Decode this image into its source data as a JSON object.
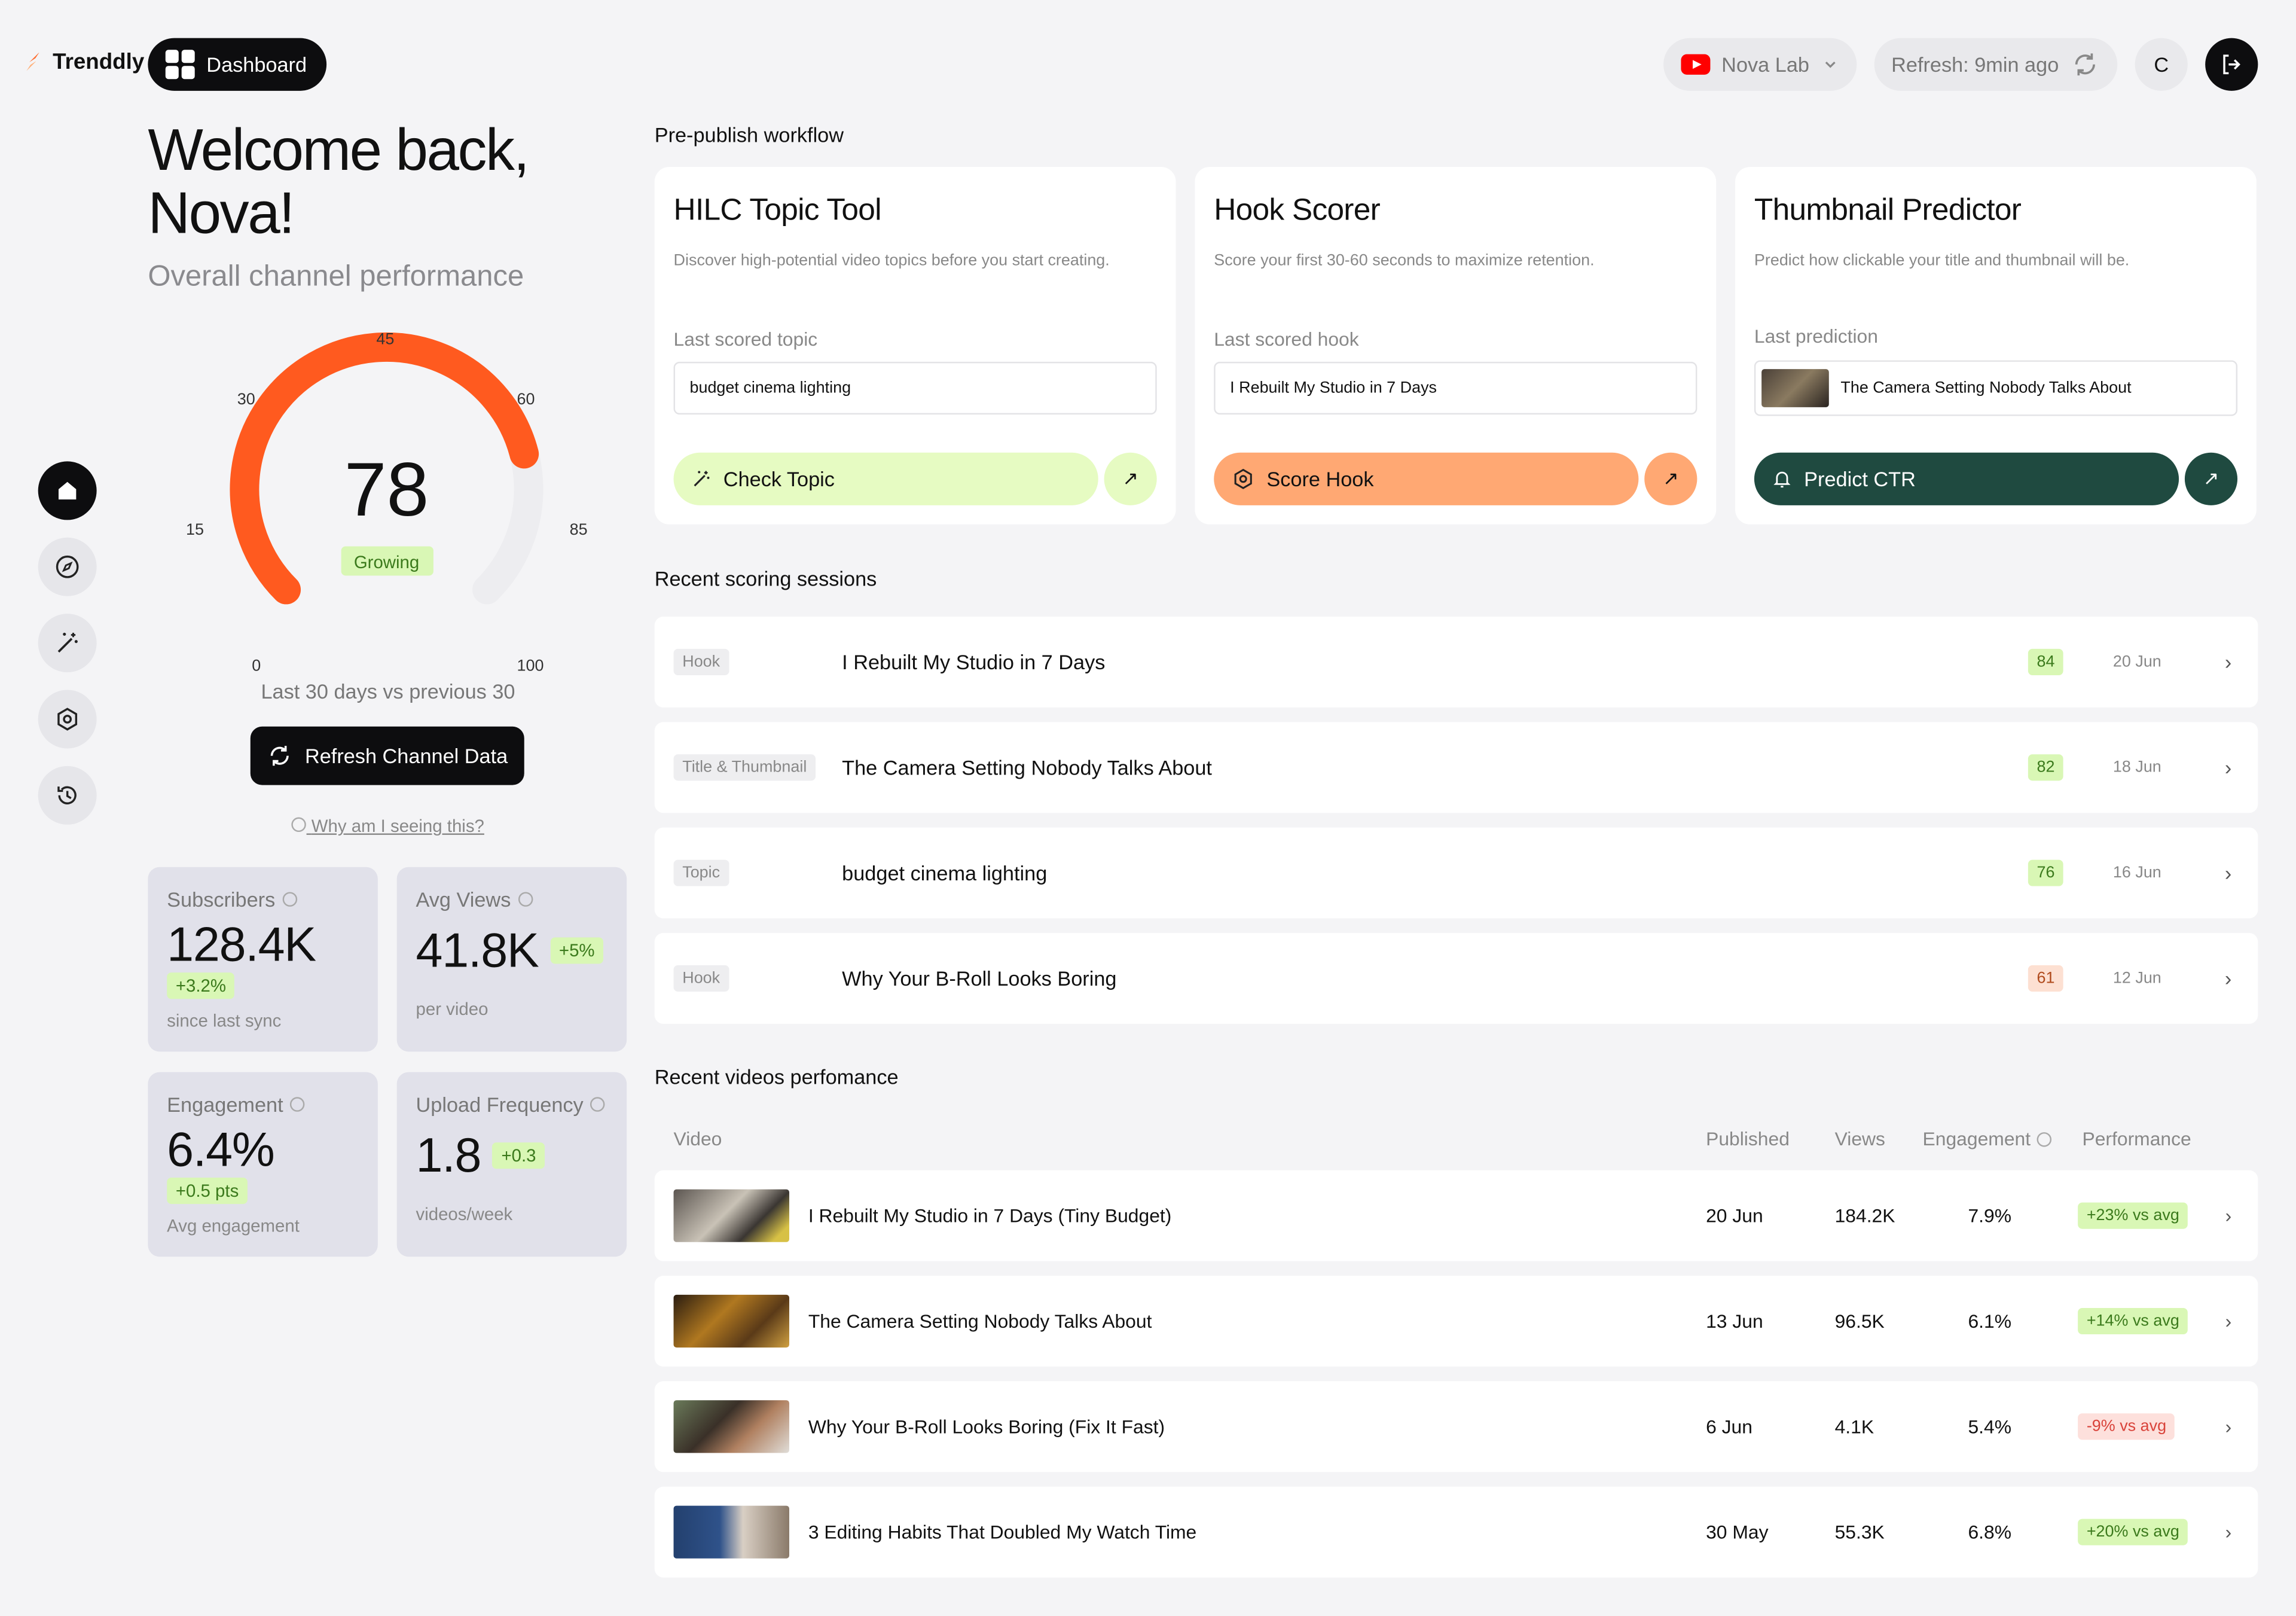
{
  "app": {
    "name": "Trenddly",
    "nav_label": "Dashboard"
  },
  "header": {
    "channel": "Nova Lab",
    "refresh": "Refresh: 9min ago",
    "avatar_initial": "C"
  },
  "welcome": {
    "line1": "Welcome back,",
    "line2": "Nova!",
    "subtitle": "Overall channel performance"
  },
  "gauge": {
    "value": "78",
    "value_num": 78,
    "status": "Growing",
    "ticks": [
      "0",
      "15",
      "30",
      "45",
      "60",
      "85",
      "100"
    ],
    "caption": "Last 30 days vs previous 30",
    "refresh_button": "Refresh Channel Data",
    "why_link": "Why am I seeing this?",
    "accent": "#ff5a1f"
  },
  "stats": [
    {
      "label": "Subscribers",
      "value": "128.4K",
      "delta": "+3.2%",
      "sub": "since last sync"
    },
    {
      "label": "Avg Views",
      "value": "41.8K",
      "delta": "+5%",
      "sub": "per video"
    },
    {
      "label": "Engagement",
      "value": "6.4%",
      "delta": "+0.5 pts",
      "sub": "Avg engagement"
    },
    {
      "label": "Upload Frequency",
      "value": "1.8",
      "delta": "+0.3",
      "sub": "videos/week"
    }
  ],
  "workflow": {
    "title": "Pre-publish workflow",
    "tools": [
      {
        "name": "HILC Topic Tool",
        "desc": "Discover high-potential video topics before you start creating.",
        "last_label": "Last scored topic",
        "last_value": "budget cinema lighting",
        "action": "Check Topic",
        "color": "#e6fbc2"
      },
      {
        "name": "Hook Scorer",
        "desc": "Score your first 30-60 seconds to maximize retention.",
        "last_label": "Last scored hook",
        "last_value": "I Rebuilt My Studio in 7 Days",
        "action": "Score Hook",
        "color": "#ffa873"
      },
      {
        "name": "Thumbnail Predictor",
        "desc": "Predict how clickable your title and thumbnail will be.",
        "last_label": "Last prediction",
        "last_value": "The Camera Setting Nobody Talks About",
        "action": "Predict CTR",
        "color": "#1f4a40"
      }
    ]
  },
  "sessions": {
    "title": "Recent scoring sessions",
    "rows": [
      {
        "tag": "Hook",
        "title": "I Rebuilt My Studio in 7 Days",
        "score": "84",
        "date": "20 Jun"
      },
      {
        "tag": "Title & Thumbnail",
        "title": "The Camera Setting Nobody Talks About",
        "score": "82",
        "date": "18 Jun"
      },
      {
        "tag": "Topic",
        "title": "budget cinema lighting",
        "score": "76",
        "date": "16 Jun"
      },
      {
        "tag": "Hook",
        "title": "Why Your B-Roll Looks Boring",
        "score": "61",
        "date": "12 Jun"
      }
    ]
  },
  "videos": {
    "title": "Recent videos perfomance",
    "columns": [
      "Video",
      "Published",
      "Views",
      "Engagement",
      "Performance"
    ],
    "rows": [
      {
        "title": "I Rebuilt My Studio in 7 Days (Tiny Budget)",
        "published": "20 Jun",
        "views": "184.2K",
        "engagement": "7.9%",
        "performance": "+23% vs avg"
      },
      {
        "title": "The Camera Setting Nobody Talks About",
        "published": "13 Jun",
        "views": "96.5K",
        "engagement": "6.1%",
        "performance": "+14% vs avg"
      },
      {
        "title": "Why Your B-Roll Looks Boring (Fix It Fast)",
        "published": "6 Jun",
        "views": "4.1K",
        "engagement": "5.4%",
        "performance": "-9% vs avg"
      },
      {
        "title": "3 Editing Habits That Doubled My Watch Time",
        "published": "30 May",
        "views": "55.3K",
        "engagement": "6.8%",
        "performance": "+20% vs avg"
      }
    ]
  }
}
